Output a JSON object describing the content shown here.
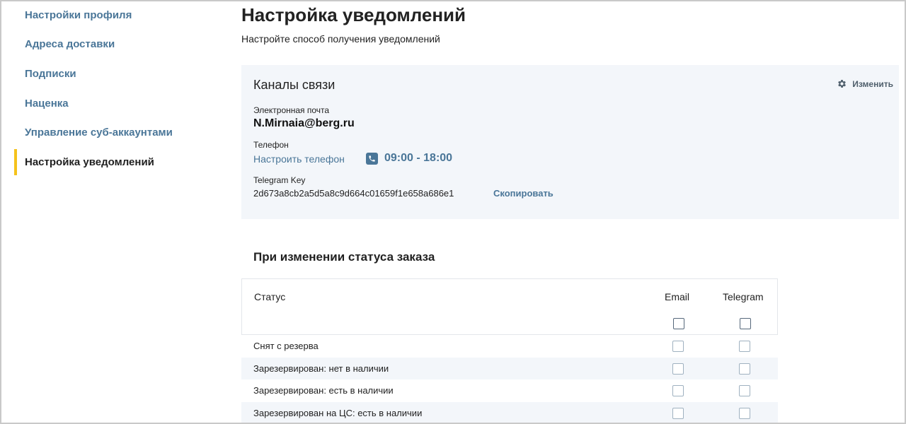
{
  "sidebar": {
    "items": [
      {
        "label": "Настройки профиля",
        "active": false
      },
      {
        "label": "Адреса доставки",
        "active": false
      },
      {
        "label": "Подписки",
        "active": false
      },
      {
        "label": "Наценка",
        "active": false
      },
      {
        "label": "Управление суб-аккаунтами",
        "active": false
      },
      {
        "label": "Настройка уведомлений",
        "active": true
      }
    ]
  },
  "header": {
    "title": "Настройка уведомлений",
    "subtitle": "Настройте способ получения уведомлений"
  },
  "channels": {
    "title": "Каналы связи",
    "edit_label": "Изменить",
    "email_label": "Электронная почта",
    "email_value": "N.Mirnaia@berg.ru",
    "phone_label": "Телефон",
    "phone_link": "Настроить телефон",
    "phone_hours": "09:00 - 18:00",
    "telegram_label": "Telegram Key",
    "telegram_key": "2d673a8cb2a5d5a8c9d664c01659f1e658a686e1",
    "copy_label": "Скопировать"
  },
  "order_status": {
    "title": "При изменении статуса заказа",
    "columns": {
      "status": "Статус",
      "email": "Email",
      "telegram": "Telegram"
    },
    "rows": [
      "Снят с резерва",
      "Зарезервирован: нет в наличии",
      "Зарезервирован: есть в наличии",
      "Зарезервирован на ЦС: есть в наличии"
    ]
  },
  "colors": {
    "accent": "#4a7698",
    "active_marker": "#f5c21b",
    "panel_bg": "#f3f6fa"
  }
}
